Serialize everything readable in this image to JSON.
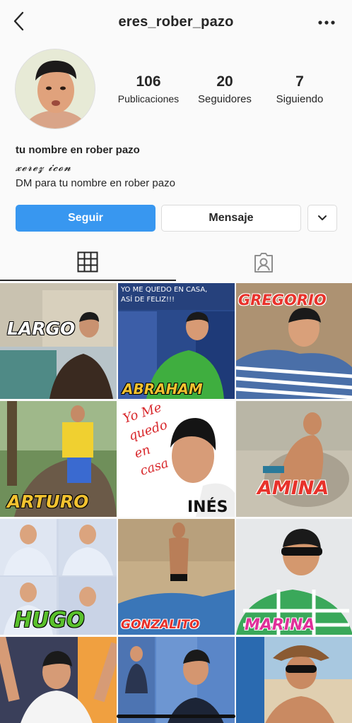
{
  "header": {
    "username": "eres_rober_pazo"
  },
  "stats": [
    {
      "count": "106",
      "label": "Publicaciones"
    },
    {
      "count": "20",
      "label": "Seguidores"
    },
    {
      "count": "7",
      "label": "Siguiendo"
    }
  ],
  "bio": {
    "name": "tu nombre en rober pazo",
    "tagline": "𝔁𝓮𝓻𝓮𝔃 𝓲𝓬𝓸𝓷",
    "description": "DM para tu nombre en rober pazo"
  },
  "actions": {
    "follow": "Seguir",
    "message": "Mensaje"
  },
  "posts": [
    {
      "caption": "LARGO",
      "color": "#ffffff"
    },
    {
      "caption": "ABRAHAM",
      "color": "#f2c230",
      "overlay": "YO ME QUEDO EN CASA, ASÍ DE FELIZ!!!"
    },
    {
      "caption": "GREGORIO",
      "color": "#e8322b"
    },
    {
      "caption": "ARTURO",
      "color": "#f2c230"
    },
    {
      "caption": "INÉS",
      "color": "#111111",
      "handwriting": "Yo Me quedo en casa"
    },
    {
      "caption": "AMINA",
      "color": "#e8322b"
    },
    {
      "caption": "HUGO",
      "color": "#5ac12c"
    },
    {
      "caption": "GONZALITO",
      "color": "#e8322b"
    },
    {
      "caption": "MARINA",
      "color": "#e0309a"
    },
    {
      "caption": "",
      "color": ""
    },
    {
      "caption": "",
      "color": ""
    },
    {
      "caption": "",
      "color": ""
    }
  ],
  "colors": {
    "accent": "#3897f0",
    "text": "#262626",
    "border": "#dbdbdb"
  }
}
